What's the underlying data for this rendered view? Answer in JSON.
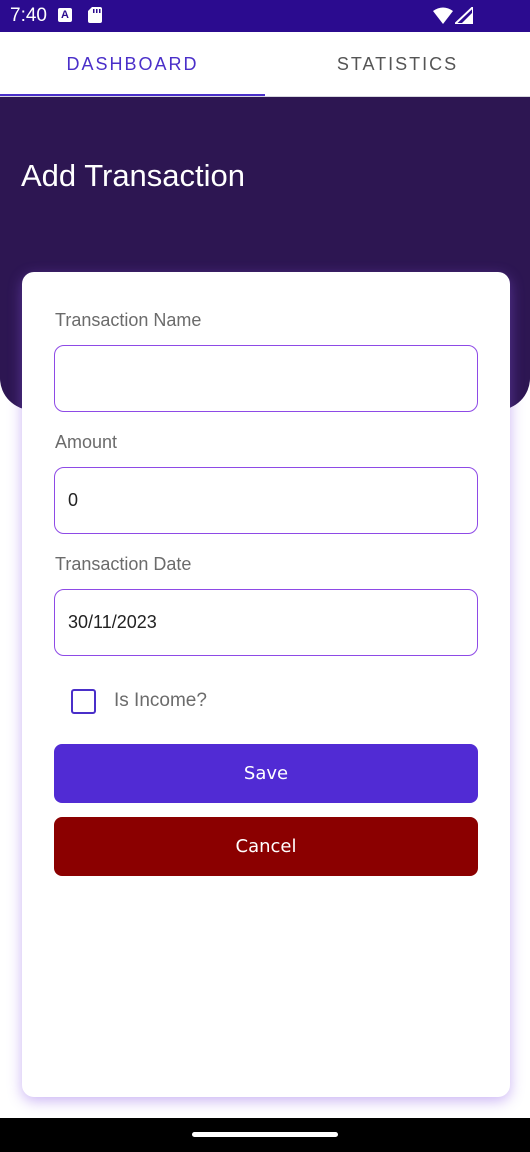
{
  "status_bar": {
    "time": "7:40",
    "icons": [
      "a-notification-icon",
      "sd-card-icon",
      "wifi-icon",
      "signal-icon"
    ]
  },
  "tabs": [
    {
      "label": "DASHBOARD",
      "selected": true
    },
    {
      "label": "STATISTICS",
      "selected": false
    }
  ],
  "header": {
    "title": "Add Transaction"
  },
  "form": {
    "transaction_name": {
      "label": "Transaction Name",
      "value": ""
    },
    "amount": {
      "label": "Amount",
      "value": "0"
    },
    "transaction_date": {
      "label": "Transaction Date",
      "value": "30/11/2023"
    },
    "is_income": {
      "label": "Is Income?",
      "checked": false
    },
    "save_label": "Save",
    "cancel_label": "Cancel"
  },
  "colors": {
    "status_bar": "#2b0b8f",
    "accent": "#4a2fc9",
    "header_bg": "#2d1652",
    "input_border": "#8e4ae6",
    "save_button": "#512bd4",
    "cancel_button": "#8b0000"
  }
}
